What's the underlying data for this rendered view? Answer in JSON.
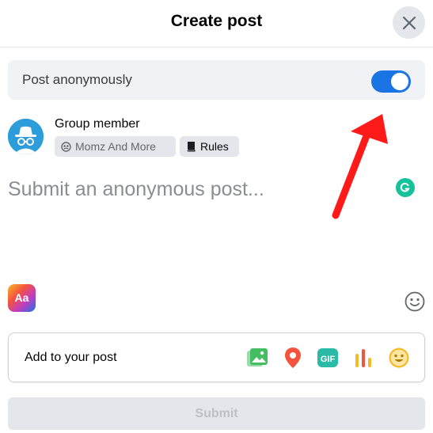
{
  "header": {
    "title": "Create post"
  },
  "anonymous": {
    "label": "Post anonymously",
    "enabled": true
  },
  "author": {
    "name": "Group member",
    "group_name": "Momz And More",
    "rules_label": "Rules"
  },
  "composer": {
    "placeholder": "Submit an anonymous post..."
  },
  "add_to_post": {
    "label": "Add to your post",
    "icons": [
      "photo-video-icon",
      "location-pin-icon",
      "gif-icon",
      "poll-icon",
      "feeling-icon"
    ]
  },
  "submit": {
    "label": "Submit"
  },
  "colors": {
    "accent": "#1b74e4",
    "annotation_arrow": "#ff1a1a",
    "photo": "#45bd62",
    "location": "#f5533d",
    "gif": "#2abba7",
    "poll": "#f7b928",
    "feeling": "#f7b928"
  }
}
